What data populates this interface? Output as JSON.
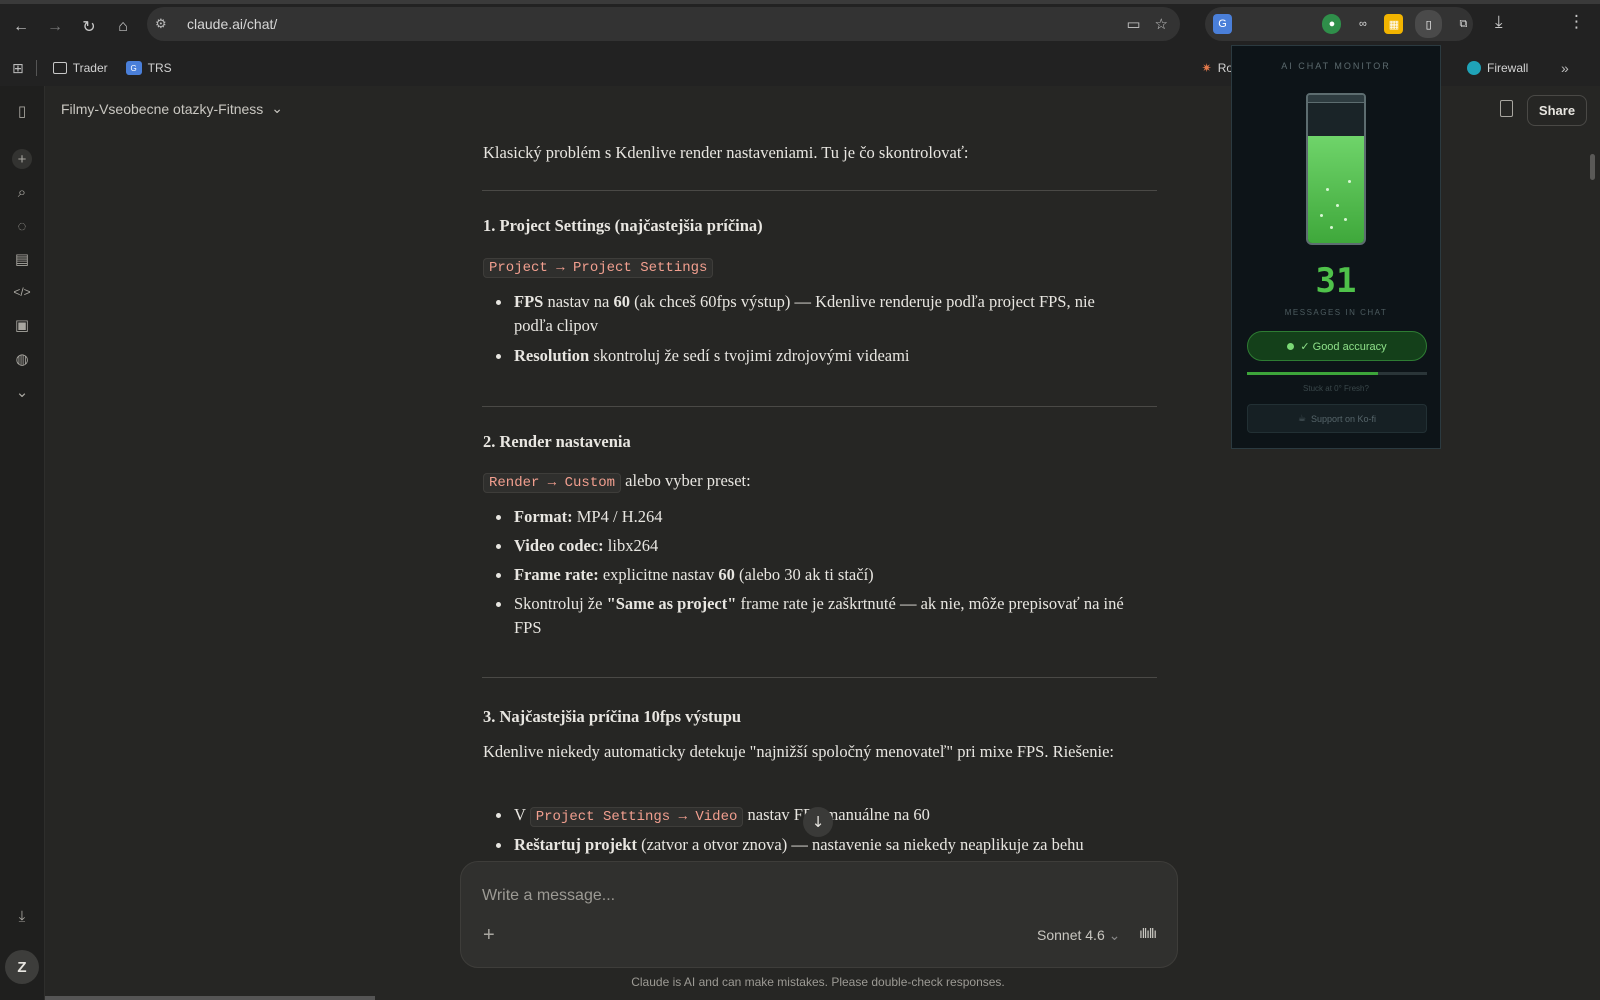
{
  "browser": {
    "url": "claude.ai/chat/",
    "bookmarks": [
      {
        "label": "Trader",
        "type": "folder"
      },
      {
        "label": "TRS",
        "type": "translate"
      },
      {
        "label": "Routi",
        "type": "site"
      },
      {
        "label": "Firewall",
        "type": "site"
      }
    ],
    "more_bookmarks": "»"
  },
  "chat": {
    "title": "Filmy-Vseobecne otazky-Fitness",
    "share_label": "Share",
    "intro": "Klasický problém s Kdenlive render nastaveniami. Tu je čo skontrolovať:",
    "sections": [
      {
        "heading": "1. Project Settings (najčastejšia príčina)",
        "code": "Project → Project Settings",
        "items": [
          {
            "bold": "FPS",
            "text1": " nastav na ",
            "bold2": "60",
            "text2": " (ak chceš 60fps výstup) — Kdenlive renderuje podľa project FPS, nie podľa clipov"
          },
          {
            "bold": "Resolution",
            "text1": " skontroluj že sedí s tvojimi zdrojovými videami"
          }
        ]
      },
      {
        "heading": "2. Render nastavenia",
        "code": "Render → Custom",
        "code_suffix": " alebo vyber preset:",
        "items": [
          {
            "bold": "Format:",
            "text1": " MP4 / H.264"
          },
          {
            "bold": "Video codec:",
            "text1": " libx264"
          },
          {
            "bold": "Frame rate:",
            "text1": " explicitne nastav ",
            "bold2": "60",
            "text2": " (alebo 30 ak ti stačí)"
          },
          {
            "text0": "Skontroluj že ",
            "bold": "\"Same as project\"",
            "text1": " frame rate je zaškrtnuté — ak nie, môže prepisovať na iné FPS"
          }
        ]
      },
      {
        "heading": "3. Najčastejšia príčina 10fps výstupu",
        "intro": "Kdenlive niekedy automaticky detekuje \"najnižší spoločný menovateľ\" pri mixe FPS. Riešenie:",
        "items": [
          {
            "text0": "V ",
            "code": "Project Settings → Video",
            "text1": " nastav FPS manuálne na 60"
          },
          {
            "bold": "Reštartuj projekt",
            "text1": " (zatvor a otvor znova) — nastavenie sa niekedy neaplikuje za behu"
          }
        ]
      }
    ],
    "input_placeholder": "Write a message...",
    "model": "Sonnet 4.6",
    "disclaimer": "Claude is AI and can make mistakes. Please double-check responses."
  },
  "user": {
    "initial": "Z"
  },
  "extension_popup": {
    "title": "AI CHAT MONITOR",
    "count": "31",
    "count_label": "MESSAGES IN CHAT",
    "status": "✓ Good accuracy",
    "fill_fraction": 0.72,
    "progress_fraction": 0.73,
    "stuck_text": "Stuck at 0° Fresh?",
    "support_label": "Support on Ko-fi",
    "colors": {
      "liquid": "#4fc24a",
      "status_bg": "#14401a"
    }
  },
  "icons": {
    "back": "←",
    "forward": "→",
    "reload": "↻",
    "home": "⌂",
    "plus": "+",
    "chevron": "⌄",
    "arrow_down": "↓",
    "download": "⤓",
    "menu": "⋮"
  }
}
